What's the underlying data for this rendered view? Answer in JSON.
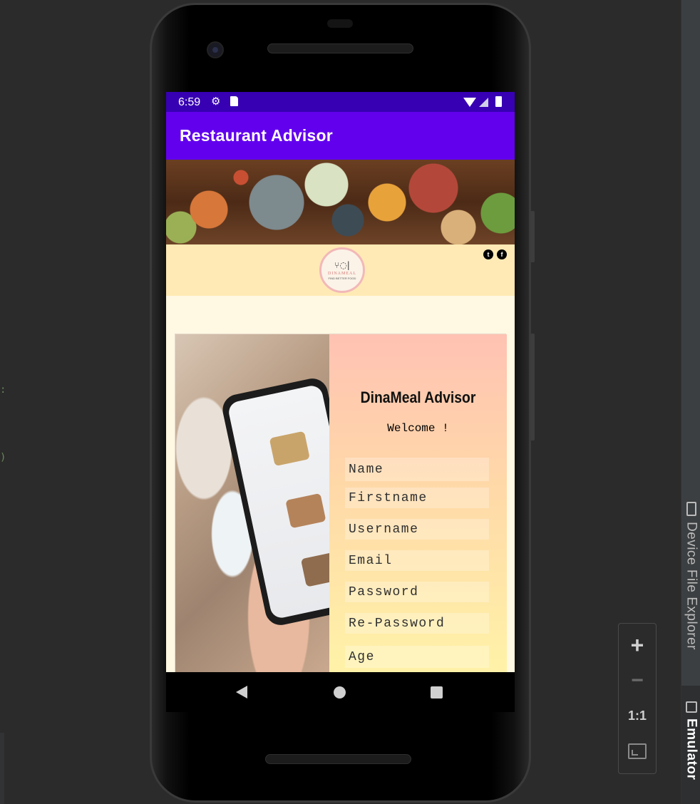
{
  "status_bar": {
    "time": "6:59",
    "icons_left": [
      "settings-icon",
      "sd-card-icon"
    ],
    "icons_right": [
      "wifi-icon",
      "signal-icon",
      "battery-icon"
    ],
    "background": "#3700b3"
  },
  "app_bar": {
    "title": "Restaurant Advisor",
    "background": "#6200ee"
  },
  "header": {
    "logo_name": "DINAMEAL",
    "logo_tagline": "FIND BETTER FOOD",
    "social": [
      "twitter-icon",
      "facebook-icon"
    ],
    "background": "#ffeab5"
  },
  "form": {
    "title": "DinaMeal Advisor",
    "subtitle": "Welcome !",
    "fields": [
      {
        "placeholder": "Name"
      },
      {
        "placeholder": "Firstname"
      },
      {
        "placeholder": "Username"
      },
      {
        "placeholder": "Email"
      },
      {
        "placeholder": "Password"
      },
      {
        "placeholder": "Re-Password"
      },
      {
        "placeholder": "Age"
      }
    ]
  },
  "emulator_controls": {
    "zoom_in": "+",
    "zoom_out": "−",
    "actual_size": "1:1"
  },
  "ide_tabs": {
    "device_file_explorer": "Device File Explorer",
    "emulator": "Emulator"
  }
}
